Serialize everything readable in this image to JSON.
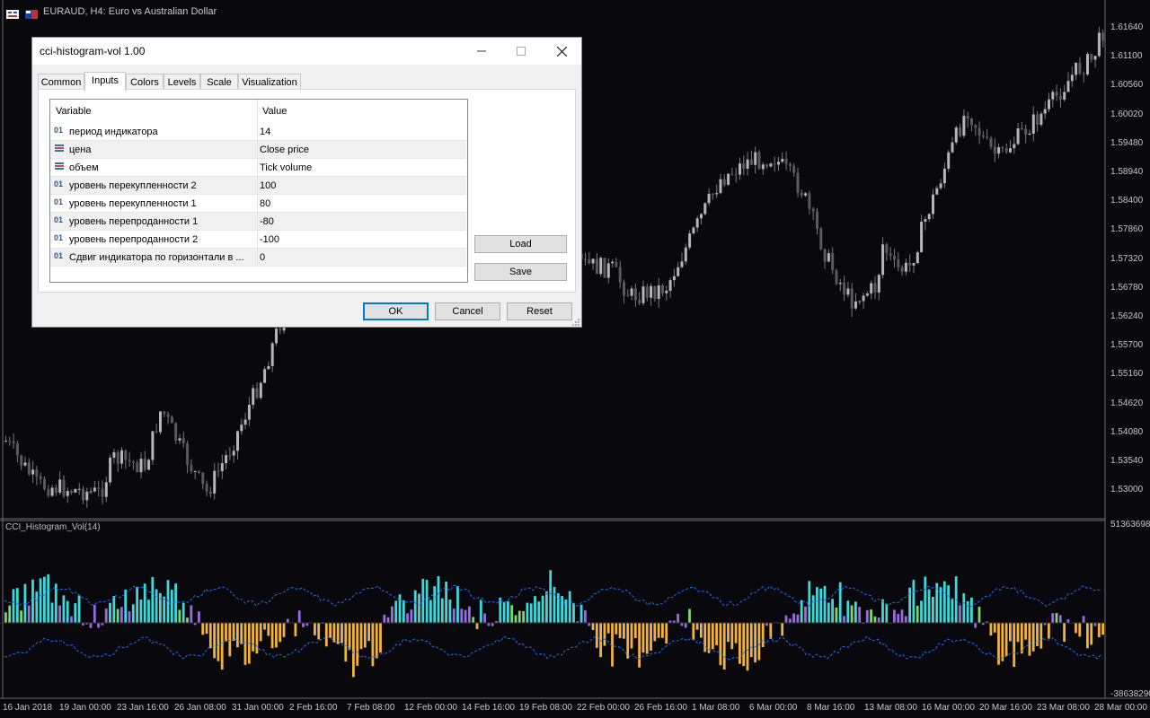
{
  "chart_window": {
    "title": "EURAUD, H4:  Euro vs Australian Dollar",
    "subwindow_title": "CCI_Histogram_Vol(14)",
    "price_axis": [
      "1.61640",
      "1.61100",
      "1.60560",
      "1.60020",
      "1.59480",
      "1.58940",
      "1.58400",
      "1.57860",
      "1.57320",
      "1.56780",
      "1.56240",
      "1.55700",
      "1.55160",
      "1.54620",
      "1.54080",
      "1.53540",
      "1.53000"
    ],
    "sub_axis_top": "51363698",
    "sub_axis_bottom": "-38638290",
    "time_axis": [
      "16 Jan 2018",
      "19 Jan 00:00",
      "23 Jan 16:00",
      "26 Jan 08:00",
      "31 Jan 00:00",
      "2 Feb 16:00",
      "7 Feb 08:00",
      "12 Feb 00:00",
      "14 Feb 16:00",
      "19 Feb 08:00",
      "22 Feb 00:00",
      "26 Feb 16:00",
      "1 Mar 08:00",
      "6 Mar 00:00",
      "8 Mar 16:00",
      "13 Mar 08:00",
      "16 Mar 00:00",
      "20 Mar 16:00",
      "23 Mar 08:00",
      "28 Mar 00:00"
    ],
    "colors": {
      "background": "#08080d",
      "candles": "#9a9a9a",
      "hist_up": "#3fd8d8",
      "hist_up_mid": "#7cd86a",
      "hist_down": "#f0b43c",
      "hist_mid": "#9a6adf",
      "line": "#1e6fff"
    }
  },
  "dialog": {
    "title": "cci-histogram-vol 1.00",
    "tabs": [
      "Common",
      "Inputs",
      "Colors",
      "Levels",
      "Scale",
      "Visualization"
    ],
    "active_tab": "Inputs",
    "grid": {
      "col_variable": "Variable",
      "col_value": "Value",
      "rows": [
        {
          "icon": "01",
          "name": "период индикатора",
          "value": "14"
        },
        {
          "icon": "enum",
          "name": "цена",
          "value": "Close price"
        },
        {
          "icon": "enum",
          "name": "объем",
          "value": "Tick volume"
        },
        {
          "icon": "01",
          "name": "уровень перекупленности 2",
          "value": "100"
        },
        {
          "icon": "01",
          "name": "уровень перекупленности 1",
          "value": "80"
        },
        {
          "icon": "01",
          "name": "уровень перепроданности 1",
          "value": "-80"
        },
        {
          "icon": "01",
          "name": "уровень перепроданности 2",
          "value": "-100"
        },
        {
          "icon": "01",
          "name": "Сдвиг индикатора по горизонтали в ...",
          "value": "0"
        }
      ]
    },
    "buttons": {
      "load": "Load",
      "save": "Save",
      "ok": "OK",
      "cancel": "Cancel",
      "reset": "Reset"
    }
  }
}
